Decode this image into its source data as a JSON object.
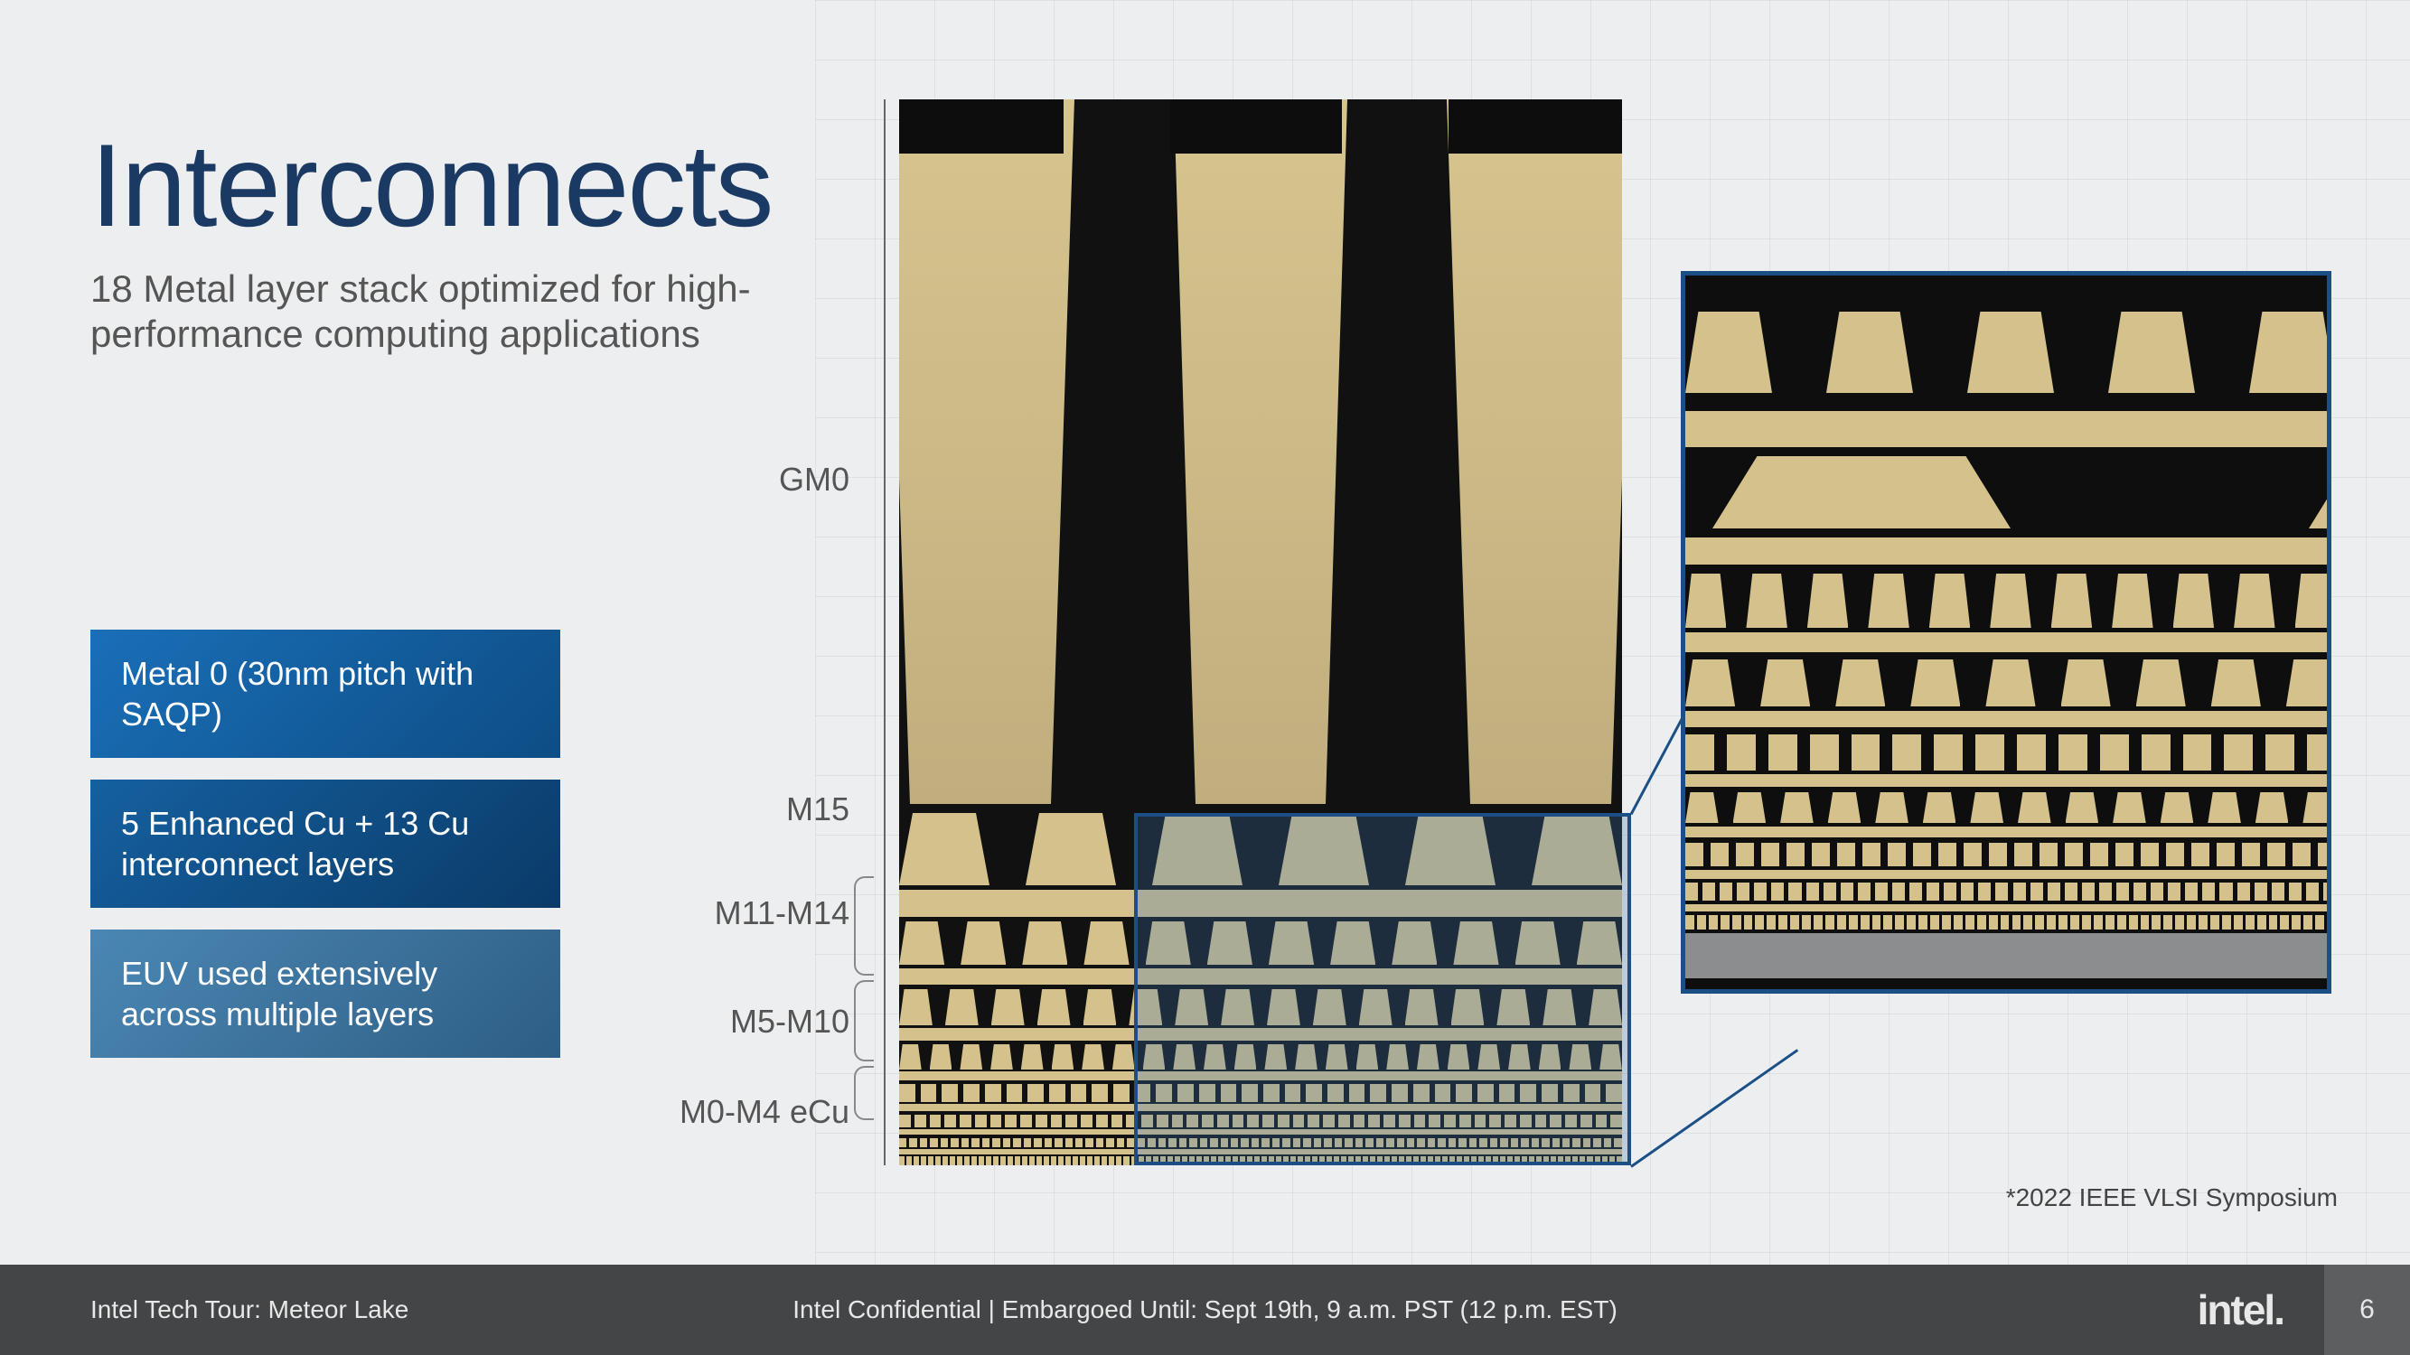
{
  "title": "Interconnects",
  "subtitle": "18 Metal layer stack optimized for high-performance computing applications",
  "callouts": [
    "Metal 0 (30nm pitch with SAQP)",
    "5 Enhanced Cu + 13 Cu interconnect layers",
    "EUV used extensively across multiple layers"
  ],
  "layer_labels": {
    "gm0": "GM0",
    "m15": "M15",
    "m11_14": "M11-M14",
    "m5_10": "M5-M10",
    "m0_4": "M0-M4 eCu"
  },
  "footnote": "*2022 IEEE VLSI Symposium",
  "footer": {
    "left": "Intel Tech Tour: Meteor Lake",
    "center": "Intel Confidential   |   Embargoed Until: Sept 19th, 9 a.m. PST (12 p.m. EST)",
    "logo": "intel.",
    "page": "6"
  },
  "colors": {
    "title": "#1b3a63",
    "accent": "#1b4f86",
    "gold": "#d4c18b"
  }
}
